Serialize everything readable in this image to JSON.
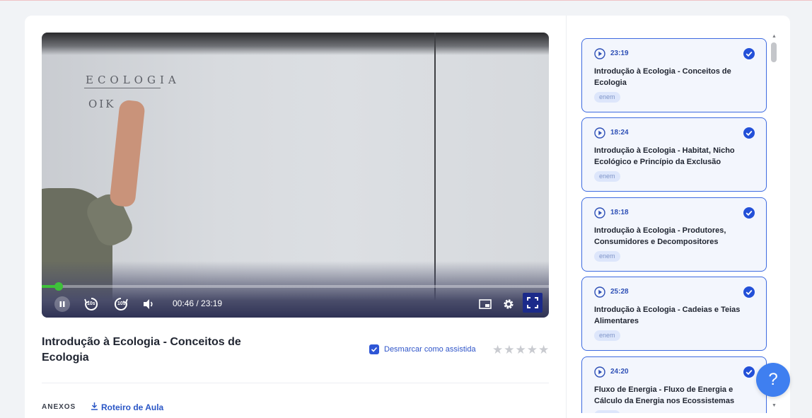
{
  "player": {
    "board_text_1": "ECOLOGIA",
    "board_text_2": "OIK",
    "time_current": "00:46",
    "time_total": "23:19",
    "time_display": "00:46 / 23:19",
    "progress": 0.033,
    "progress_color": "#3ec13a",
    "controls": [
      "pause-icon",
      "rewind-10-icon",
      "forward-10-icon",
      "volume-icon",
      "picture-in-picture-icon",
      "gear-icon",
      "fullscreen-icon"
    ],
    "rewind_label": "10s",
    "forward_label": "10s"
  },
  "lesson": {
    "title": "Introdução à Ecologia - Conceitos de Ecologia",
    "watched_label": "Desmarcar como assistida",
    "watched": true,
    "rating": 0,
    "rating_max": 5
  },
  "attachments": {
    "label": "ANEXOS",
    "items": [
      {
        "label": "Roteiro de Aula",
        "icon": "download-icon"
      }
    ]
  },
  "playlist": [
    {
      "duration": "23:19",
      "title": "Introdução à Ecologia - Conceitos de Ecologia",
      "tag": "enem",
      "watched": true
    },
    {
      "duration": "18:24",
      "title": "Introdução à Ecologia - Habitat, Nicho Ecológico e Princípio da Exclusão",
      "tag": "enem",
      "watched": true
    },
    {
      "duration": "18:18",
      "title": "Introdução à Ecologia - Produtores, Consumidores e Decompositores",
      "tag": "enem",
      "watched": true
    },
    {
      "duration": "25:28",
      "title": "Introdução à Ecologia - Cadeias e Teias Alimentares",
      "tag": "enem",
      "watched": true
    },
    {
      "duration": "24:20",
      "title": "Fluxo de Energia - Fluxo de Energia e Cálculo da Energia nos Ecossistemas",
      "tag": "enem",
      "watched": true
    }
  ],
  "help": {
    "label": "?"
  },
  "colors": {
    "accent": "#2e56d6",
    "card_border": "#3d6ae0",
    "help_button": "#3f7ff0"
  }
}
